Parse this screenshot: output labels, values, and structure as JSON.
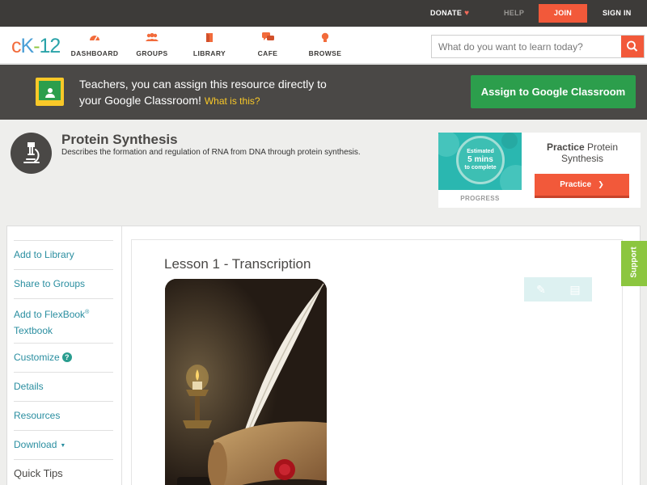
{
  "topbar": {
    "donate": "DONATE",
    "help": "HELP",
    "join": "JOIN",
    "signin": "SIGN IN"
  },
  "header": {
    "logo": {
      "c": "c",
      "k": "K",
      "dash": "-",
      "num": "12"
    },
    "nav": [
      {
        "label": "DASHBOARD",
        "icon": "dashboard-icon"
      },
      {
        "label": "GROUPS",
        "icon": "groups-icon"
      },
      {
        "label": "LIBRARY",
        "icon": "library-icon"
      },
      {
        "label": "CAFE",
        "icon": "cafe-icon"
      },
      {
        "label": "BROWSE",
        "icon": "browse-icon"
      }
    ],
    "search_placeholder": "What do you want to learn today?"
  },
  "classroom_banner": {
    "line1": "Teachers, you can assign this resource directly to",
    "line2": "your Google Classroom!",
    "what_link": "What is this?",
    "button": "Assign to Google Classroom"
  },
  "concept": {
    "title": "Protein Synthesis",
    "description": "Describes the formation and regulation of RNA from DNA through protein synthesis."
  },
  "practice_card": {
    "estimated": "Estimated",
    "mins": "5 mins",
    "to_complete": "to complete",
    "progress_label": "PROGRESS",
    "title_bold": "Practice",
    "title_rest": "Protein Synthesis",
    "button": "Practice"
  },
  "sidebar": {
    "items": [
      {
        "label": "Add to Library"
      },
      {
        "label": "Share to Groups"
      },
      {
        "label": "Add to FlexBook",
        "sup": "®",
        "label2": "Textbook"
      },
      {
        "label": "Customize"
      },
      {
        "label": "Details"
      },
      {
        "label": "Resources"
      },
      {
        "label": "Download"
      },
      {
        "label": "Quick Tips"
      }
    ]
  },
  "lesson": {
    "title": "Lesson 1 - Transcription"
  },
  "support": "Support",
  "colors": {
    "accent_orange": "#f2593a",
    "classroom_green": "#2c9e4c",
    "link_teal": "#2a8ea0",
    "support_green": "#8cc63f"
  }
}
